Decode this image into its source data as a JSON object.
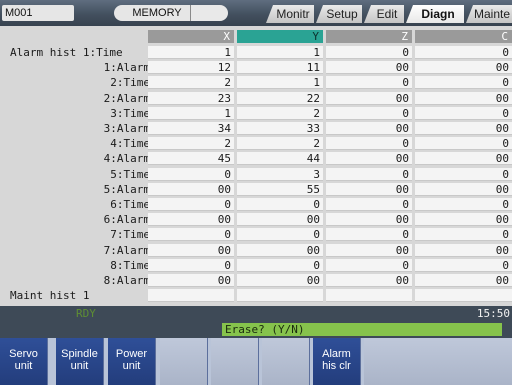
{
  "topbar": {
    "program": "M001",
    "mode": "MEMORY",
    "tabs": [
      {
        "label": "Monitr",
        "active": false
      },
      {
        "label": "Setup",
        "active": false
      },
      {
        "label": "Edit",
        "active": false
      },
      {
        "label": "Diagn",
        "active": true
      },
      {
        "label": "Mainte",
        "active": false
      }
    ]
  },
  "table": {
    "columns": [
      "X",
      "Y",
      "Z",
      "C"
    ],
    "selected_column": "Y",
    "rows": [
      {
        "label": "Alarm hist 1:Time",
        "values": [
          "1",
          "1",
          "0",
          "0"
        ]
      },
      {
        "label": "1:Alarm",
        "values": [
          "12",
          "11",
          "00",
          "00"
        ]
      },
      {
        "label": "2:Time",
        "values": [
          "2",
          "1",
          "0",
          "0"
        ]
      },
      {
        "label": "2:Alarm",
        "values": [
          "23",
          "22",
          "00",
          "00"
        ]
      },
      {
        "label": "3:Time",
        "values": [
          "1",
          "2",
          "0",
          "0"
        ]
      },
      {
        "label": "3:Alarm",
        "values": [
          "34",
          "33",
          "00",
          "00"
        ]
      },
      {
        "label": "4:Time",
        "values": [
          "2",
          "2",
          "0",
          "0"
        ]
      },
      {
        "label": "4:Alarm",
        "values": [
          "45",
          "44",
          "00",
          "00"
        ]
      },
      {
        "label": "5:Time",
        "values": [
          "0",
          "3",
          "0",
          "0"
        ]
      },
      {
        "label": "5:Alarm",
        "values": [
          "00",
          "55",
          "00",
          "00"
        ]
      },
      {
        "label": "6:Time",
        "values": [
          "0",
          "0",
          "0",
          "0"
        ]
      },
      {
        "label": "6:Alarm",
        "values": [
          "00",
          "00",
          "00",
          "00"
        ]
      },
      {
        "label": "7:Time",
        "values": [
          "0",
          "0",
          "0",
          "0"
        ]
      },
      {
        "label": "7:Alarm",
        "values": [
          "00",
          "00",
          "00",
          "00"
        ]
      },
      {
        "label": "8:Time",
        "values": [
          "0",
          "0",
          "0",
          "0"
        ]
      },
      {
        "label": "8:Alarm",
        "values": [
          "00",
          "00",
          "00",
          "00"
        ]
      },
      {
        "label": "Maint hist 1",
        "values": [
          "",
          "",
          "",
          ""
        ]
      }
    ]
  },
  "status": {
    "state": "RDY",
    "time": "15:50",
    "prompt": "Erase? (Y/N)"
  },
  "softkeys": [
    {
      "line1": "Servo",
      "line2": "unit"
    },
    {
      "line1": "Spindle",
      "line2": "unit"
    },
    {
      "line1": "Power",
      "line2": "unit"
    },
    {
      "line1": "",
      "line2": ""
    },
    {
      "line1": "",
      "line2": ""
    },
    {
      "line1": "",
      "line2": ""
    },
    {
      "line1": "Alarm",
      "line2": "his clr"
    }
  ],
  "colors": {
    "selected_header": "#2aa394",
    "prompt_bg": "#86c34c",
    "softkey_bg": "#2f4f98"
  }
}
